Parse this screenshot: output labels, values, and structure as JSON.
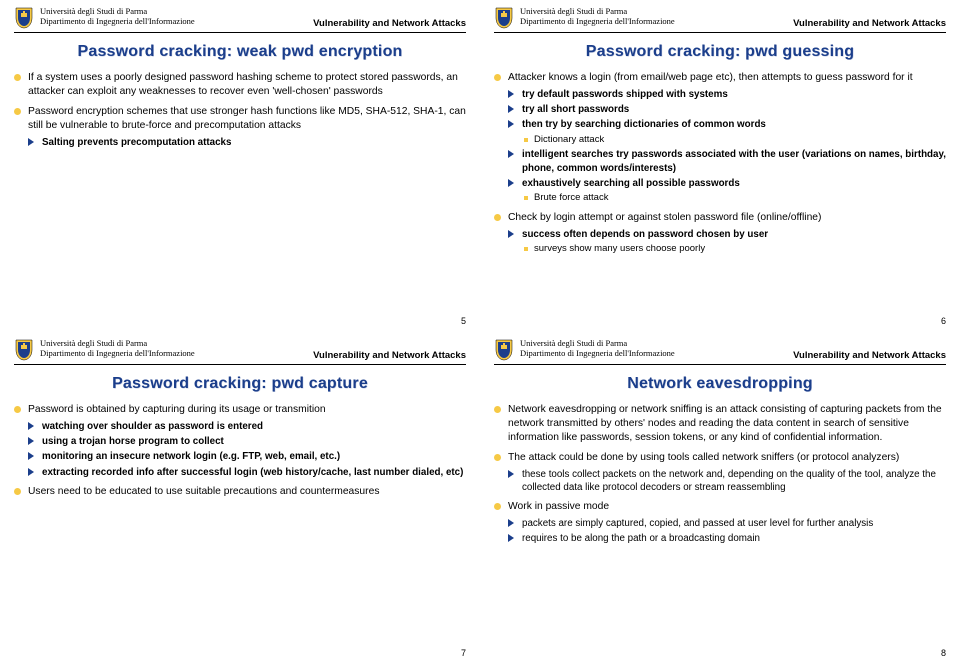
{
  "header": {
    "university": "Università degli Studi di Parma",
    "department": "Dipartimento di Ingegneria dell'Informazione",
    "course": "Vulnerability and Network Attacks"
  },
  "slides": [
    {
      "page": "5",
      "title": "Password cracking: weak pwd encryption",
      "bullets": [
        {
          "text": "If a system uses a poorly designed password hashing scheme to protect stored passwords, an attacker can exploit any weaknesses to recover even 'well-chosen' passwords"
        },
        {
          "text": "Password encryption schemes that use stronger hash functions like MD5, SHA-512, SHA-1, can still be vulnerable to brute-force and precomputation attacks",
          "sub": [
            {
              "text": "Salting prevents precomputation attacks"
            }
          ]
        }
      ]
    },
    {
      "page": "6",
      "title": "Password cracking: pwd guessing",
      "bullets": [
        {
          "text": "Attacker knows a login (from email/web page etc), then attempts to guess password for it",
          "sub": [
            {
              "text": "try default passwords shipped with systems"
            },
            {
              "text": "try all short passwords"
            },
            {
              "text": "then try by searching dictionaries of common words",
              "sub": [
                {
                  "text": "Dictionary attack"
                }
              ]
            },
            {
              "text": "intelligent searches try passwords associated with the user (variations on names, birthday, phone, common words/interests)"
            },
            {
              "text": "exhaustively searching all possible passwords",
              "sub": [
                {
                  "text": "Brute force attack"
                }
              ]
            }
          ]
        },
        {
          "text": "Check by login attempt or against stolen password file (online/offline)",
          "sub": [
            {
              "text": "success often depends on password chosen by user",
              "sub": [
                {
                  "text": "surveys show many users choose poorly"
                }
              ]
            }
          ]
        }
      ]
    },
    {
      "page": "7",
      "title": "Password cracking: pwd capture",
      "bullets": [
        {
          "text": "Password is obtained by capturing during its usage or transmition",
          "sub": [
            {
              "text": "watching over shoulder as password is entered"
            },
            {
              "text": "using a trojan horse program to collect"
            },
            {
              "text": "monitoring an insecure network login (e.g. FTP, web, email, etc.)"
            },
            {
              "text": "extracting recorded info after successful login (web history/cache, last number dialed, etc)"
            }
          ]
        },
        {
          "text": "Users need to be educated to use suitable precautions and countermeasures"
        }
      ]
    },
    {
      "page": "8",
      "title": "Network eavesdropping",
      "bullets": [
        {
          "text": "Network eavesdropping or network sniffing is an attack consisting of capturing packets from the network transmitted by others' nodes and reading the data content in search of sensitive information like passwords, session tokens, or any kind of confidential information."
        },
        {
          "text": "The attack could be done by using tools called network sniffers (or protocol analyzers)",
          "sub": [
            {
              "text": "these tools collect packets on the network and, depending on the quality of the tool, analyze the collected data like protocol decoders or stream reassembling",
              "normal": true
            }
          ]
        },
        {
          "text": "Work in passive mode",
          "sub": [
            {
              "text": "packets are simply captured, copied, and passed at user level for further analysis",
              "normal": true
            },
            {
              "text": "requires to be along the path or a broadcasting domain",
              "normal": true
            }
          ]
        }
      ]
    }
  ]
}
